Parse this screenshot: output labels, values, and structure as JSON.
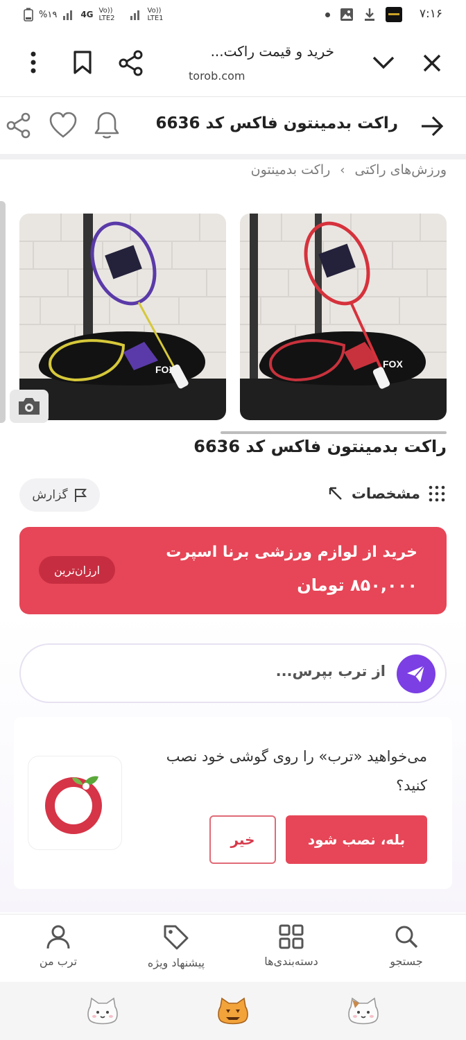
{
  "status_bar": {
    "time": "۷:۱۶",
    "battery": "%۱۹",
    "network_labels": [
      "4G",
      "Vo)) LTE2",
      "Vo)) LTE1"
    ]
  },
  "browser": {
    "title": "خرید و قیمت راکت...",
    "url": "torob.com"
  },
  "page_header": {
    "title": "راکت بدمینتون فاکس کد 6636"
  },
  "breadcrumb": {
    "items": [
      "ورزش‌های راکتی",
      "راکت بدمینتون"
    ],
    "separator": "›"
  },
  "gallery": {
    "images": [
      {
        "racket_color": "#d6323c",
        "brand": "FOX"
      },
      {
        "racket_color": "#5a3aa8",
        "brand": "FOX"
      }
    ]
  },
  "product": {
    "title": "راکت بدمینتون فاکس کد 6636",
    "report_label": "گزارش",
    "specs_label": "مشخصات"
  },
  "offer": {
    "shop": "خرید از لوازم ورزشی برنا اسپرت",
    "price": "۸۵۰,۰۰۰ تومان",
    "badge": "ارزان‌ترین",
    "color": "#e64657"
  },
  "ask": {
    "placeholder": "از ترب بپرس..."
  },
  "install_prompt": {
    "text": "می‌خواهید «ترب» را روی گوشی خود نصب کنید؟",
    "yes_label": "بله، نصب شود",
    "no_label": "خیر"
  },
  "bottom_nav": {
    "items": [
      {
        "label": "جستجو",
        "icon": "search-icon"
      },
      {
        "label": "دسته‌بندی‌ها",
        "icon": "grid-icon"
      },
      {
        "label": "پیشنهاد ویژه",
        "icon": "tag-icon"
      },
      {
        "label": "ترب من",
        "icon": "user-icon"
      }
    ]
  }
}
